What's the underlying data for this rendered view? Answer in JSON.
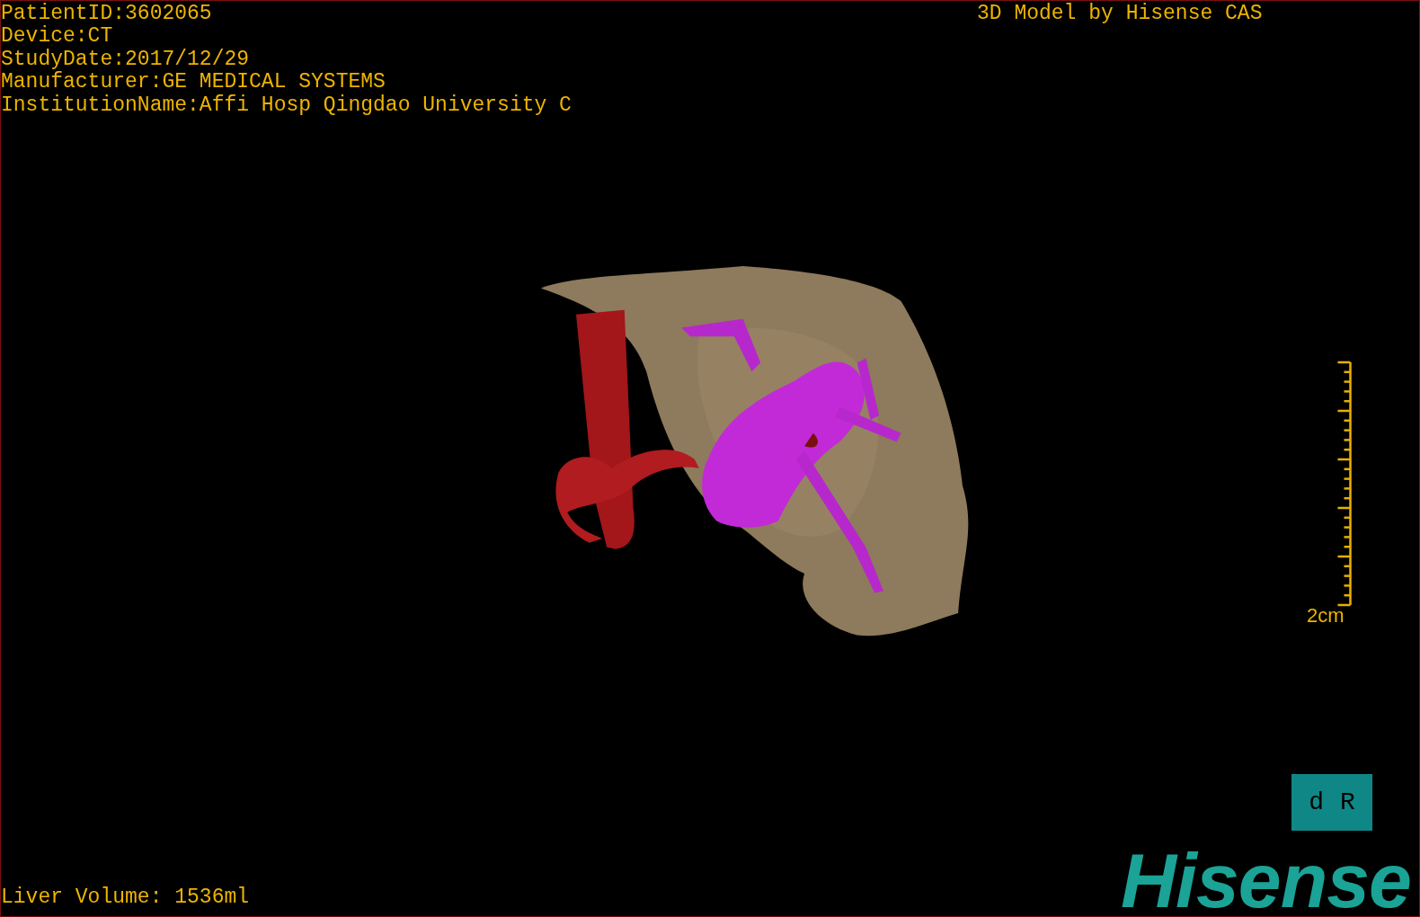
{
  "header_lines": [
    "PatientID:3602065",
    "Device:CT",
    "StudyDate:2017/12/29",
    "Manufacturer:GE MEDICAL SYSTEMS",
    "InstitutionName:Affi Hosp Qingdao University C"
  ],
  "model_credit": "3D Model by Hisense CAS",
  "scale_bar": {
    "label": "2cm"
  },
  "orientation_marker": {
    "labels": [
      "d",
      "R"
    ]
  },
  "logo": {
    "text": "Hisense"
  },
  "footer": {
    "volume": "Liver Volume: 1536ml"
  }
}
